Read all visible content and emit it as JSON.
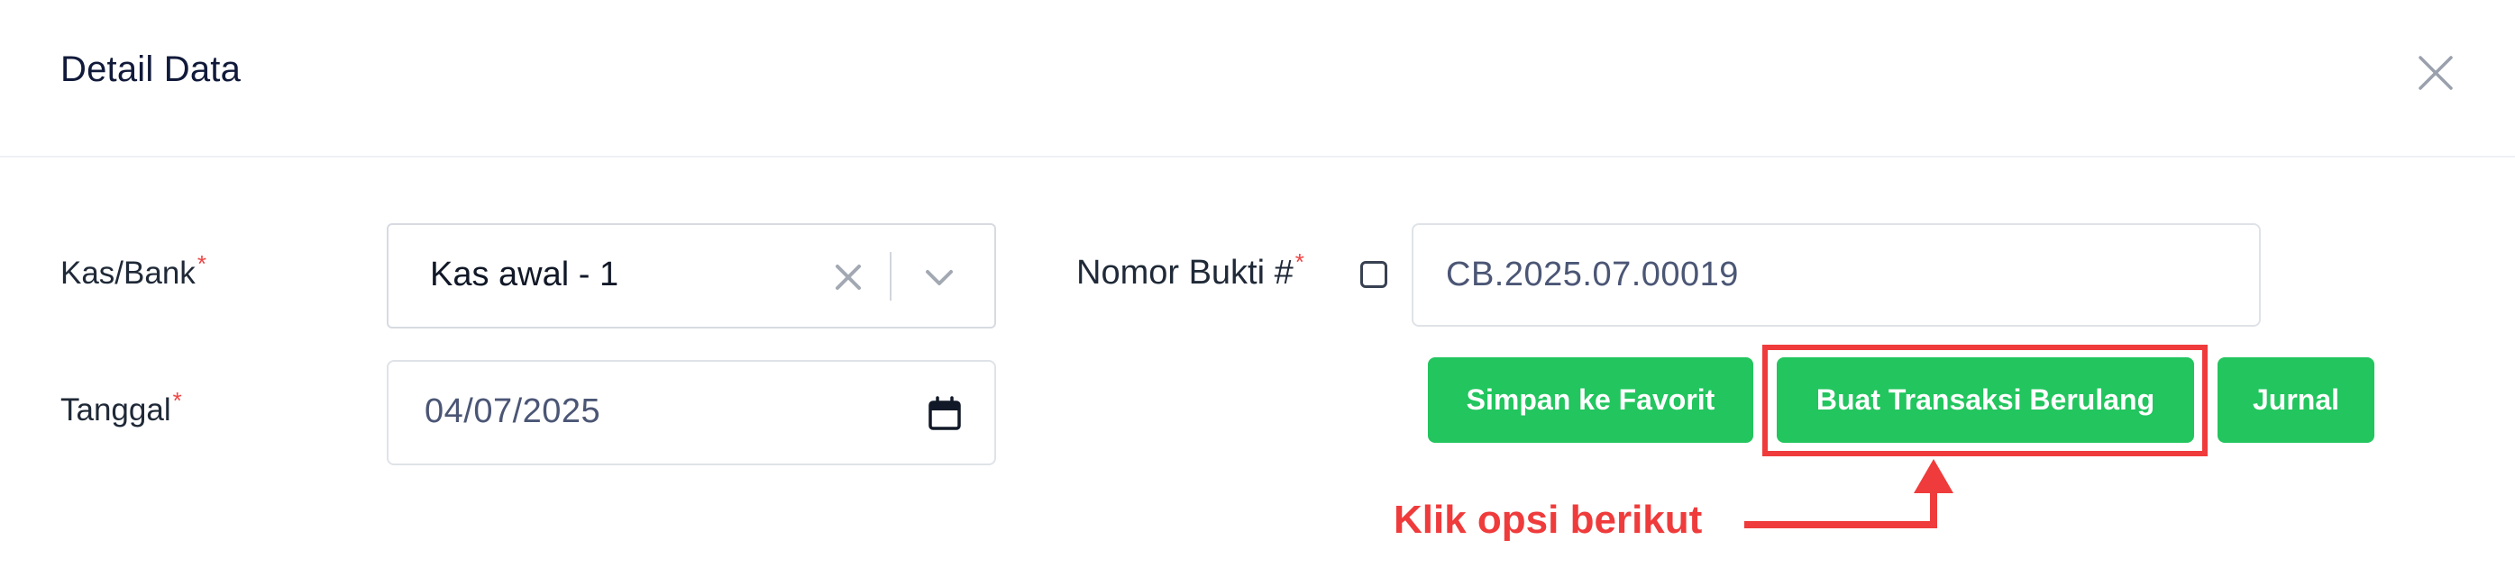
{
  "modal": {
    "title": "Detail Data",
    "close_icon": "close-icon"
  },
  "form": {
    "kas_bank": {
      "label": "Kas/Bank",
      "required_mark": "*",
      "value": "Kas awal - 1"
    },
    "tanggal": {
      "label": "Tanggal",
      "required_mark": "*",
      "value": "04/07/2025"
    },
    "nomor_bukti": {
      "label": "Nomor Bukti #",
      "required_mark": "*",
      "value": "CB.2025.07.00019"
    }
  },
  "actions": {
    "simpan_favorit": "Simpan ke Favorit",
    "buat_transaksi_berulang": "Buat Transaksi Berulang",
    "jurnal": "Jurnal"
  },
  "annotation": {
    "text": "Klik opsi berikut",
    "color": "#ef3b3b"
  },
  "colors": {
    "primary_button": "#22c55e",
    "required": "#ef4444",
    "title": "#111a3a"
  }
}
